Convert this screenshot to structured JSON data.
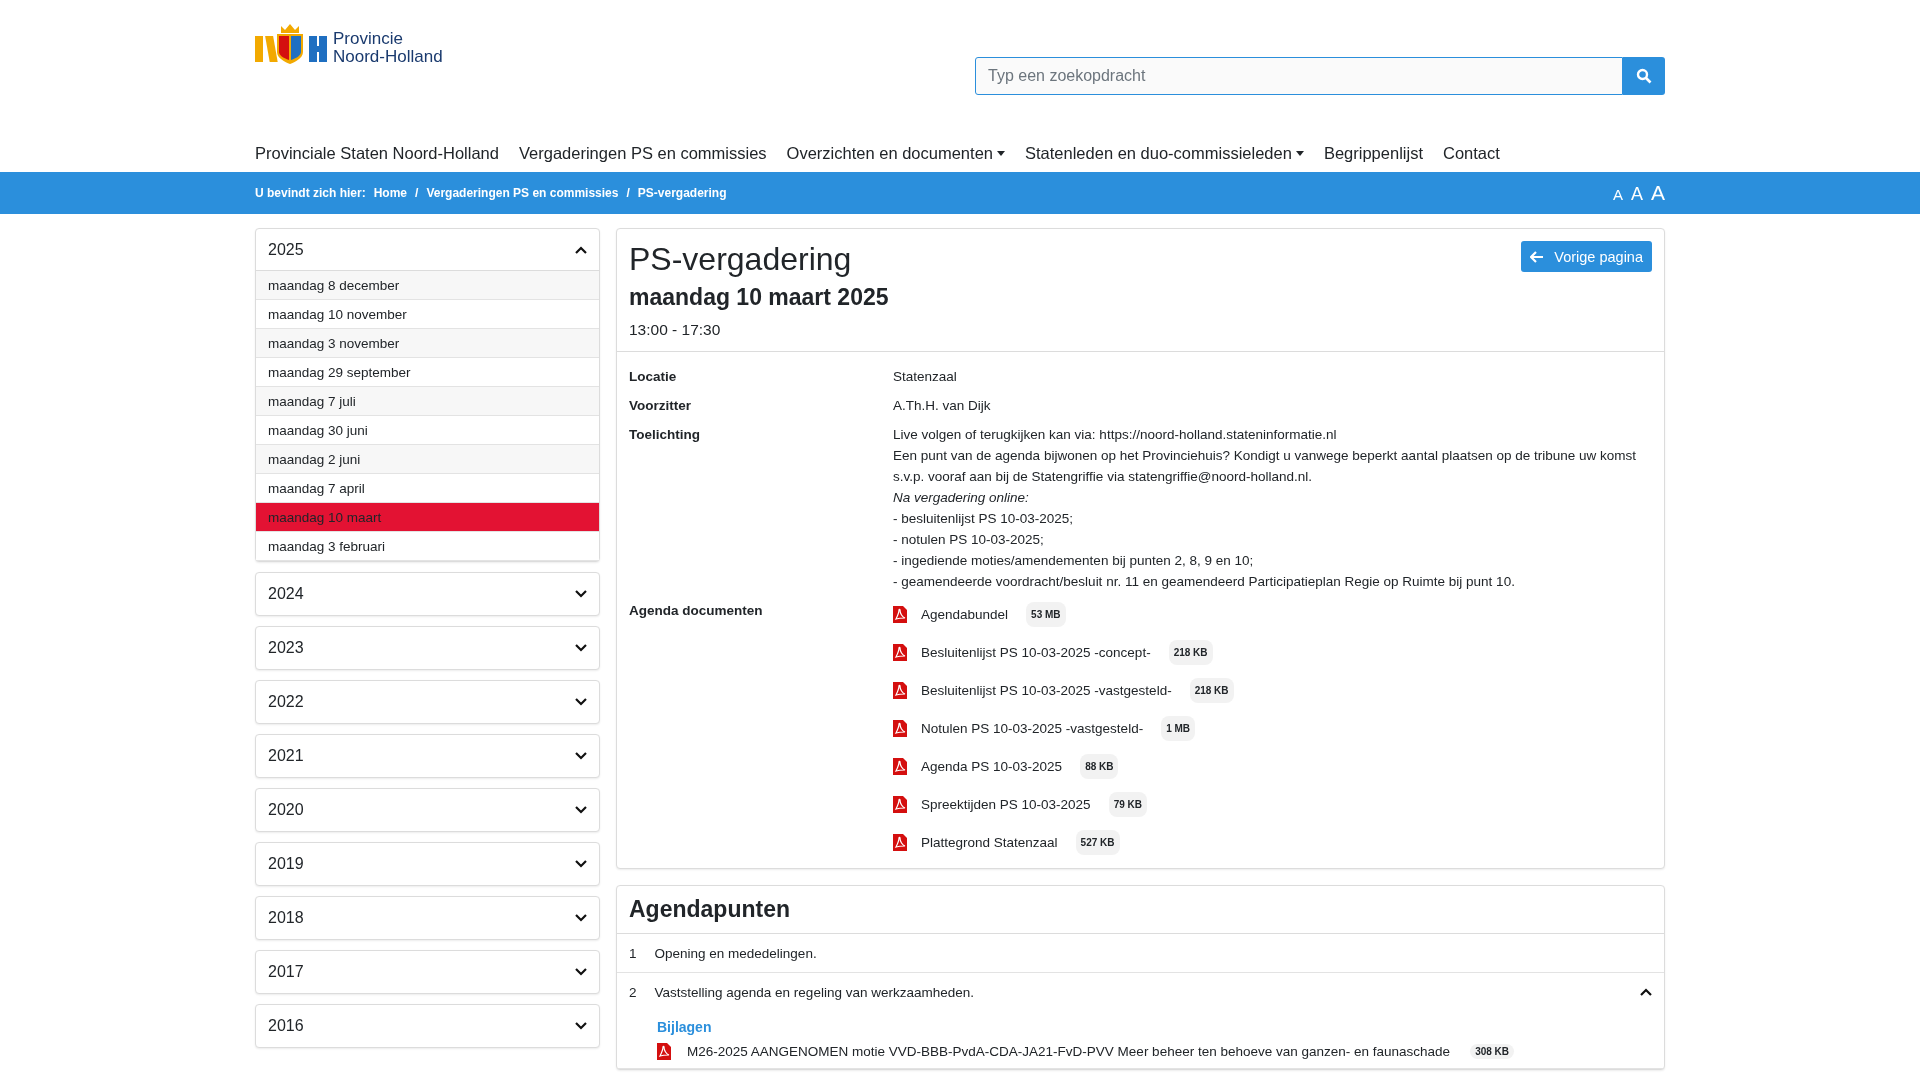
{
  "header": {
    "logo": {
      "line_1": "Provincie",
      "line_2": "Noord-Holland"
    },
    "search": {
      "placeholder": "Typ een zoekopdracht"
    }
  },
  "nav": [
    {
      "label": "Provinciale Staten Noord-Holland",
      "dropdown": false
    },
    {
      "label": "Vergaderingen PS en commissies",
      "dropdown": false
    },
    {
      "label": "Overzichten en documenten",
      "dropdown": true
    },
    {
      "label": "Statenleden en duo-commissieleden",
      "dropdown": true
    },
    {
      "label": "Begrippenlijst",
      "dropdown": false
    },
    {
      "label": "Contact",
      "dropdown": false
    }
  ],
  "breadcrumb": {
    "prefix": "U bevindt zich hier:",
    "items": [
      "Home",
      "Vergaderingen PS en commissies",
      "PS-vergadering"
    ],
    "separator": "/",
    "font_sizes": [
      "A",
      "A",
      "A"
    ]
  },
  "sidebar": {
    "years": [
      {
        "label": "2025",
        "expanded": true,
        "meetings": [
          {
            "label": "maandag 8 december",
            "selected": false
          },
          {
            "label": "maandag 10 november",
            "selected": false
          },
          {
            "label": "maandag 3 november",
            "selected": false
          },
          {
            "label": "maandag 29 september",
            "selected": false
          },
          {
            "label": "maandag 7 juli",
            "selected": false
          },
          {
            "label": "maandag 30 juni",
            "selected": false
          },
          {
            "label": "maandag 2 juni",
            "selected": false
          },
          {
            "label": "maandag 7 april",
            "selected": false
          },
          {
            "label": "maandag 10 maart",
            "selected": true
          },
          {
            "label": "maandag 3 februari",
            "selected": false
          }
        ]
      },
      {
        "label": "2024",
        "expanded": false
      },
      {
        "label": "2023",
        "expanded": false
      },
      {
        "label": "2022",
        "expanded": false
      },
      {
        "label": "2021",
        "expanded": false
      },
      {
        "label": "2020",
        "expanded": false
      },
      {
        "label": "2019",
        "expanded": false
      },
      {
        "label": "2018",
        "expanded": false
      },
      {
        "label": "2017",
        "expanded": false
      },
      {
        "label": "2016",
        "expanded": false
      }
    ]
  },
  "meeting": {
    "title": "PS-vergadering",
    "date": "maandag 10 maart 2025",
    "time": "13:00 - 17:30",
    "back_button": "Vorige pagina",
    "details": [
      {
        "label": "Locatie",
        "value": "Statenzaal"
      },
      {
        "label": "Voorzitter",
        "value": "A.Th.H. van Dijk"
      }
    ],
    "toelichting": {
      "label": "Toelichting",
      "lines": [
        {
          "text": "Live volgen of terugkijken kan via: https://noord-holland.stateninformatie.nl",
          "italic": false
        },
        {
          "text": "Een punt van de agenda bijwonen op het Provinciehuis? Kondigt u vanwege beperkt aantal plaatsen op de tribune uw komst s.v.p. vooraf aan bij de Statengriffie via statengriffie@noord-holland.nl.",
          "italic": false
        },
        {
          "text": "Na vergadering online:",
          "italic": true
        },
        {
          "text": "- besluitenlijst PS 10-03-2025;",
          "italic": false
        },
        {
          "text": "- notulen PS 10-03-2025;",
          "italic": false
        },
        {
          "text": "- ingediende moties/amendementen bij punten 2, 8, 9 en 10;",
          "italic": false
        },
        {
          "text": "- geamendeerde voordracht/besluit nr. 11 en geamendeerd Participatieplan Regie op Ruimte bij punt 10.",
          "italic": false
        }
      ]
    },
    "documents": {
      "label": "Agenda documenten",
      "items": [
        {
          "name": "Agendabundel",
          "size": "53 MB"
        },
        {
          "name": "Besluitenlijst PS 10-03-2025 -concept-",
          "size": "218 KB"
        },
        {
          "name": "Besluitenlijst PS 10-03-2025 -vastgesteld-",
          "size": "218 KB"
        },
        {
          "name": "Notulen PS 10-03-2025 -vastgesteld-",
          "size": "1 MB"
        },
        {
          "name": "Agenda PS 10-03-2025",
          "size": "88 KB"
        },
        {
          "name": "Spreektijden PS 10-03-2025",
          "size": "79 KB"
        },
        {
          "name": "Plattegrond Statenzaal",
          "size": "527 KB"
        }
      ]
    }
  },
  "agenda": {
    "title": "Agendapunten",
    "items": [
      {
        "number": "1",
        "title": "Opening en mededelingen.",
        "kind": "plain"
      },
      {
        "number": "2",
        "title": "Vaststelling agenda en regeling van werkzaamheden.",
        "kind": "expandable",
        "expanded": true,
        "attachments_label": "Bijlagen",
        "attachments": [
          {
            "name": "M26-2025 AANGENOMEN motie VVD-BBB-PvdA-CDA-JA21-FvD-PVV Meer beheer ten behoeve van ganzen- en faunaschade",
            "size": "308 KB"
          }
        ]
      }
    ]
  }
}
